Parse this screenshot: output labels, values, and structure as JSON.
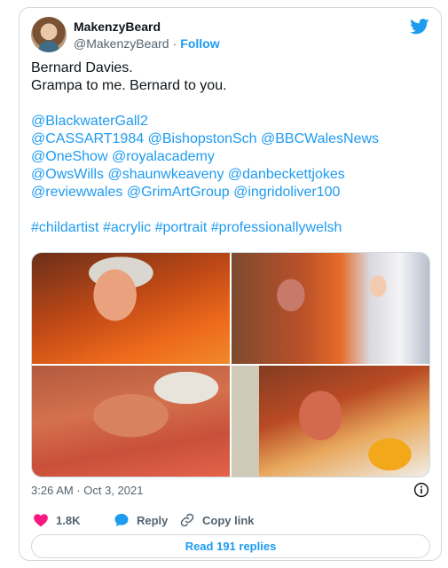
{
  "tweet": {
    "author": {
      "display_name": "MakenzyBeard",
      "handle": "@MakenzyBeard",
      "separator": "·",
      "follow_label": "Follow"
    },
    "text_lines": [
      "Bernard Davies.",
      "Grampa to me. Bernard to you."
    ],
    "mention_lines": [
      [
        " @BlackwaterGall2"
      ],
      [
        "@CASSART1984",
        "@BishopstonSch",
        "@BBCWalesNews"
      ],
      [
        "@OneShow",
        "@royalacademy"
      ],
      [
        "@OwsWills",
        "@shaunwkeaveny",
        "@danbeckettjokes"
      ],
      [
        "@reviewwales",
        "@GrimArtGroup",
        "@ingridoliver100"
      ]
    ],
    "hashtags": [
      "#childartist",
      "#acrylic",
      "#portrait",
      "#professionallywelsh"
    ],
    "timestamp": "3:26 AM · Oct 3, 2021",
    "likes_count": "1.8K",
    "reply_label": "Reply",
    "copy_link_label": "Copy link",
    "read_replies_label": "Read 191 replies"
  },
  "colors": {
    "accent": "#1d9bf0",
    "like": "#f91880",
    "text": "#0f1419",
    "muted": "#536471",
    "border": "#cfd9de"
  },
  "icons": {
    "brand": "twitter-bird-icon",
    "info": "info-icon",
    "like": "heart-icon",
    "reply": "speech-bubble-icon",
    "copy": "link-icon"
  }
}
